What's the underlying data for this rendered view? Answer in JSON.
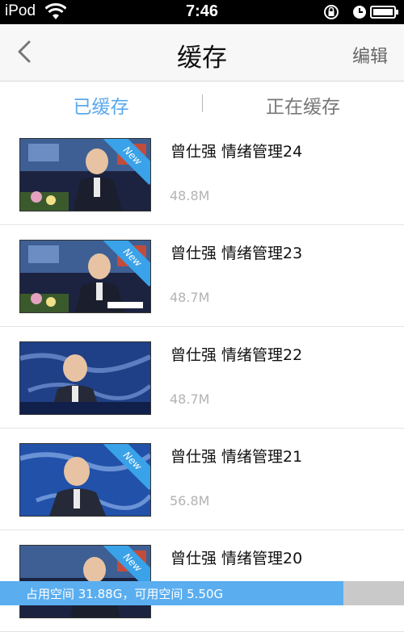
{
  "status_bar": {
    "carrier": "iPod",
    "time": "7:46"
  },
  "nav": {
    "title": "缓存",
    "edit_label": "编辑"
  },
  "tabs": [
    {
      "label": "已缓存",
      "active": true
    },
    {
      "label": "正在缓存",
      "active": false
    }
  ],
  "items": [
    {
      "title": "曾仕强 情绪管理24",
      "size": "48.8M",
      "new_badge": "New"
    },
    {
      "title": "曾仕强 情绪管理23",
      "size": "48.7M",
      "new_badge": "New"
    },
    {
      "title": "曾仕强 情绪管理22",
      "size": "48.7M",
      "new_badge": ""
    },
    {
      "title": "曾仕强 情绪管理21",
      "size": "56.8M",
      "new_badge": "New"
    },
    {
      "title": "曾仕强 情绪管理20",
      "size": "",
      "new_badge": "New"
    }
  ],
  "storage": {
    "text": "占用空间 31.88G，可用空间 5.50G",
    "used_fraction": 0.85,
    "fill_color": "#5aaef0"
  },
  "colors": {
    "accent": "#5aa9ee"
  }
}
